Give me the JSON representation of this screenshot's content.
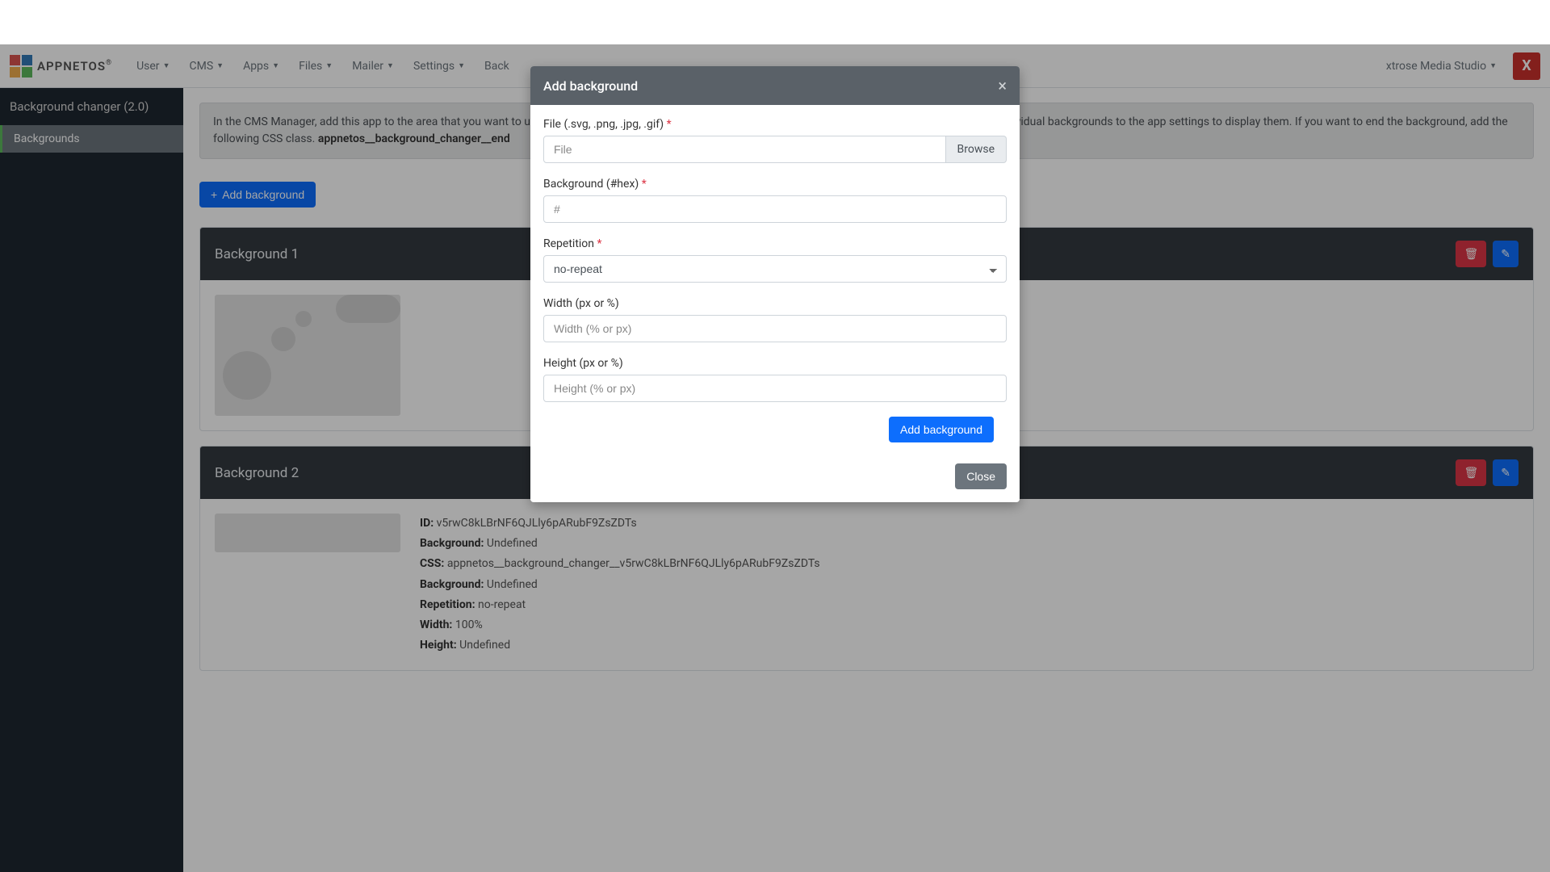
{
  "nav": {
    "brand": "APPNETOS",
    "items": [
      "User",
      "CMS",
      "Apps",
      "Files",
      "Mailer",
      "Settings",
      "Back"
    ],
    "user": "xtrose Media Studio"
  },
  "sidebar": {
    "title": "Background changer (2.0)",
    "items": [
      {
        "label": "Backgrounds"
      }
    ]
  },
  "info": {
    "text_before": "In the CMS Manager, add this app to the area that you want to use as a background. Place this app in front of containers or apps. Add the CSS classes of the individual backgrounds to the app settings to display them. If you want to end the background, add the following CSS class. ",
    "strong": "appnetos__background_changer__end"
  },
  "add_button": "Add background",
  "cards": [
    {
      "title": "Background 1"
    },
    {
      "title": "Background 2",
      "details": {
        "id_label": "ID:",
        "id": "v5rwC8kLBrNF6QJLly6pARubF9ZsZDTs",
        "bg1_label": "Background:",
        "bg1": "Undefined",
        "css_label": "CSS:",
        "css": "appnetos__background_changer__v5rwC8kLBrNF6QJLly6pARubF9ZsZDTs",
        "bg2_label": "Background:",
        "bg2": "Undefined",
        "rep_label": "Repetition:",
        "rep": "no-repeat",
        "w_label": "Width:",
        "w": "100%",
        "h_label": "Height:",
        "h": "Undefined"
      }
    }
  ],
  "modal": {
    "title": "Add background",
    "file_label": "File (.svg, .png, .jpg, .gif)",
    "file_placeholder": "File",
    "browse": "Browse",
    "hex_label": "Background (#hex)",
    "hex_placeholder": "#",
    "rep_label": "Repetition",
    "rep_value": "no-repeat",
    "width_label": "Width (px or %)",
    "width_placeholder": "Width (% or px)",
    "height_label": "Height (px or %)",
    "height_placeholder": "Height (% or px)",
    "submit": "Add background",
    "close": "Close"
  }
}
